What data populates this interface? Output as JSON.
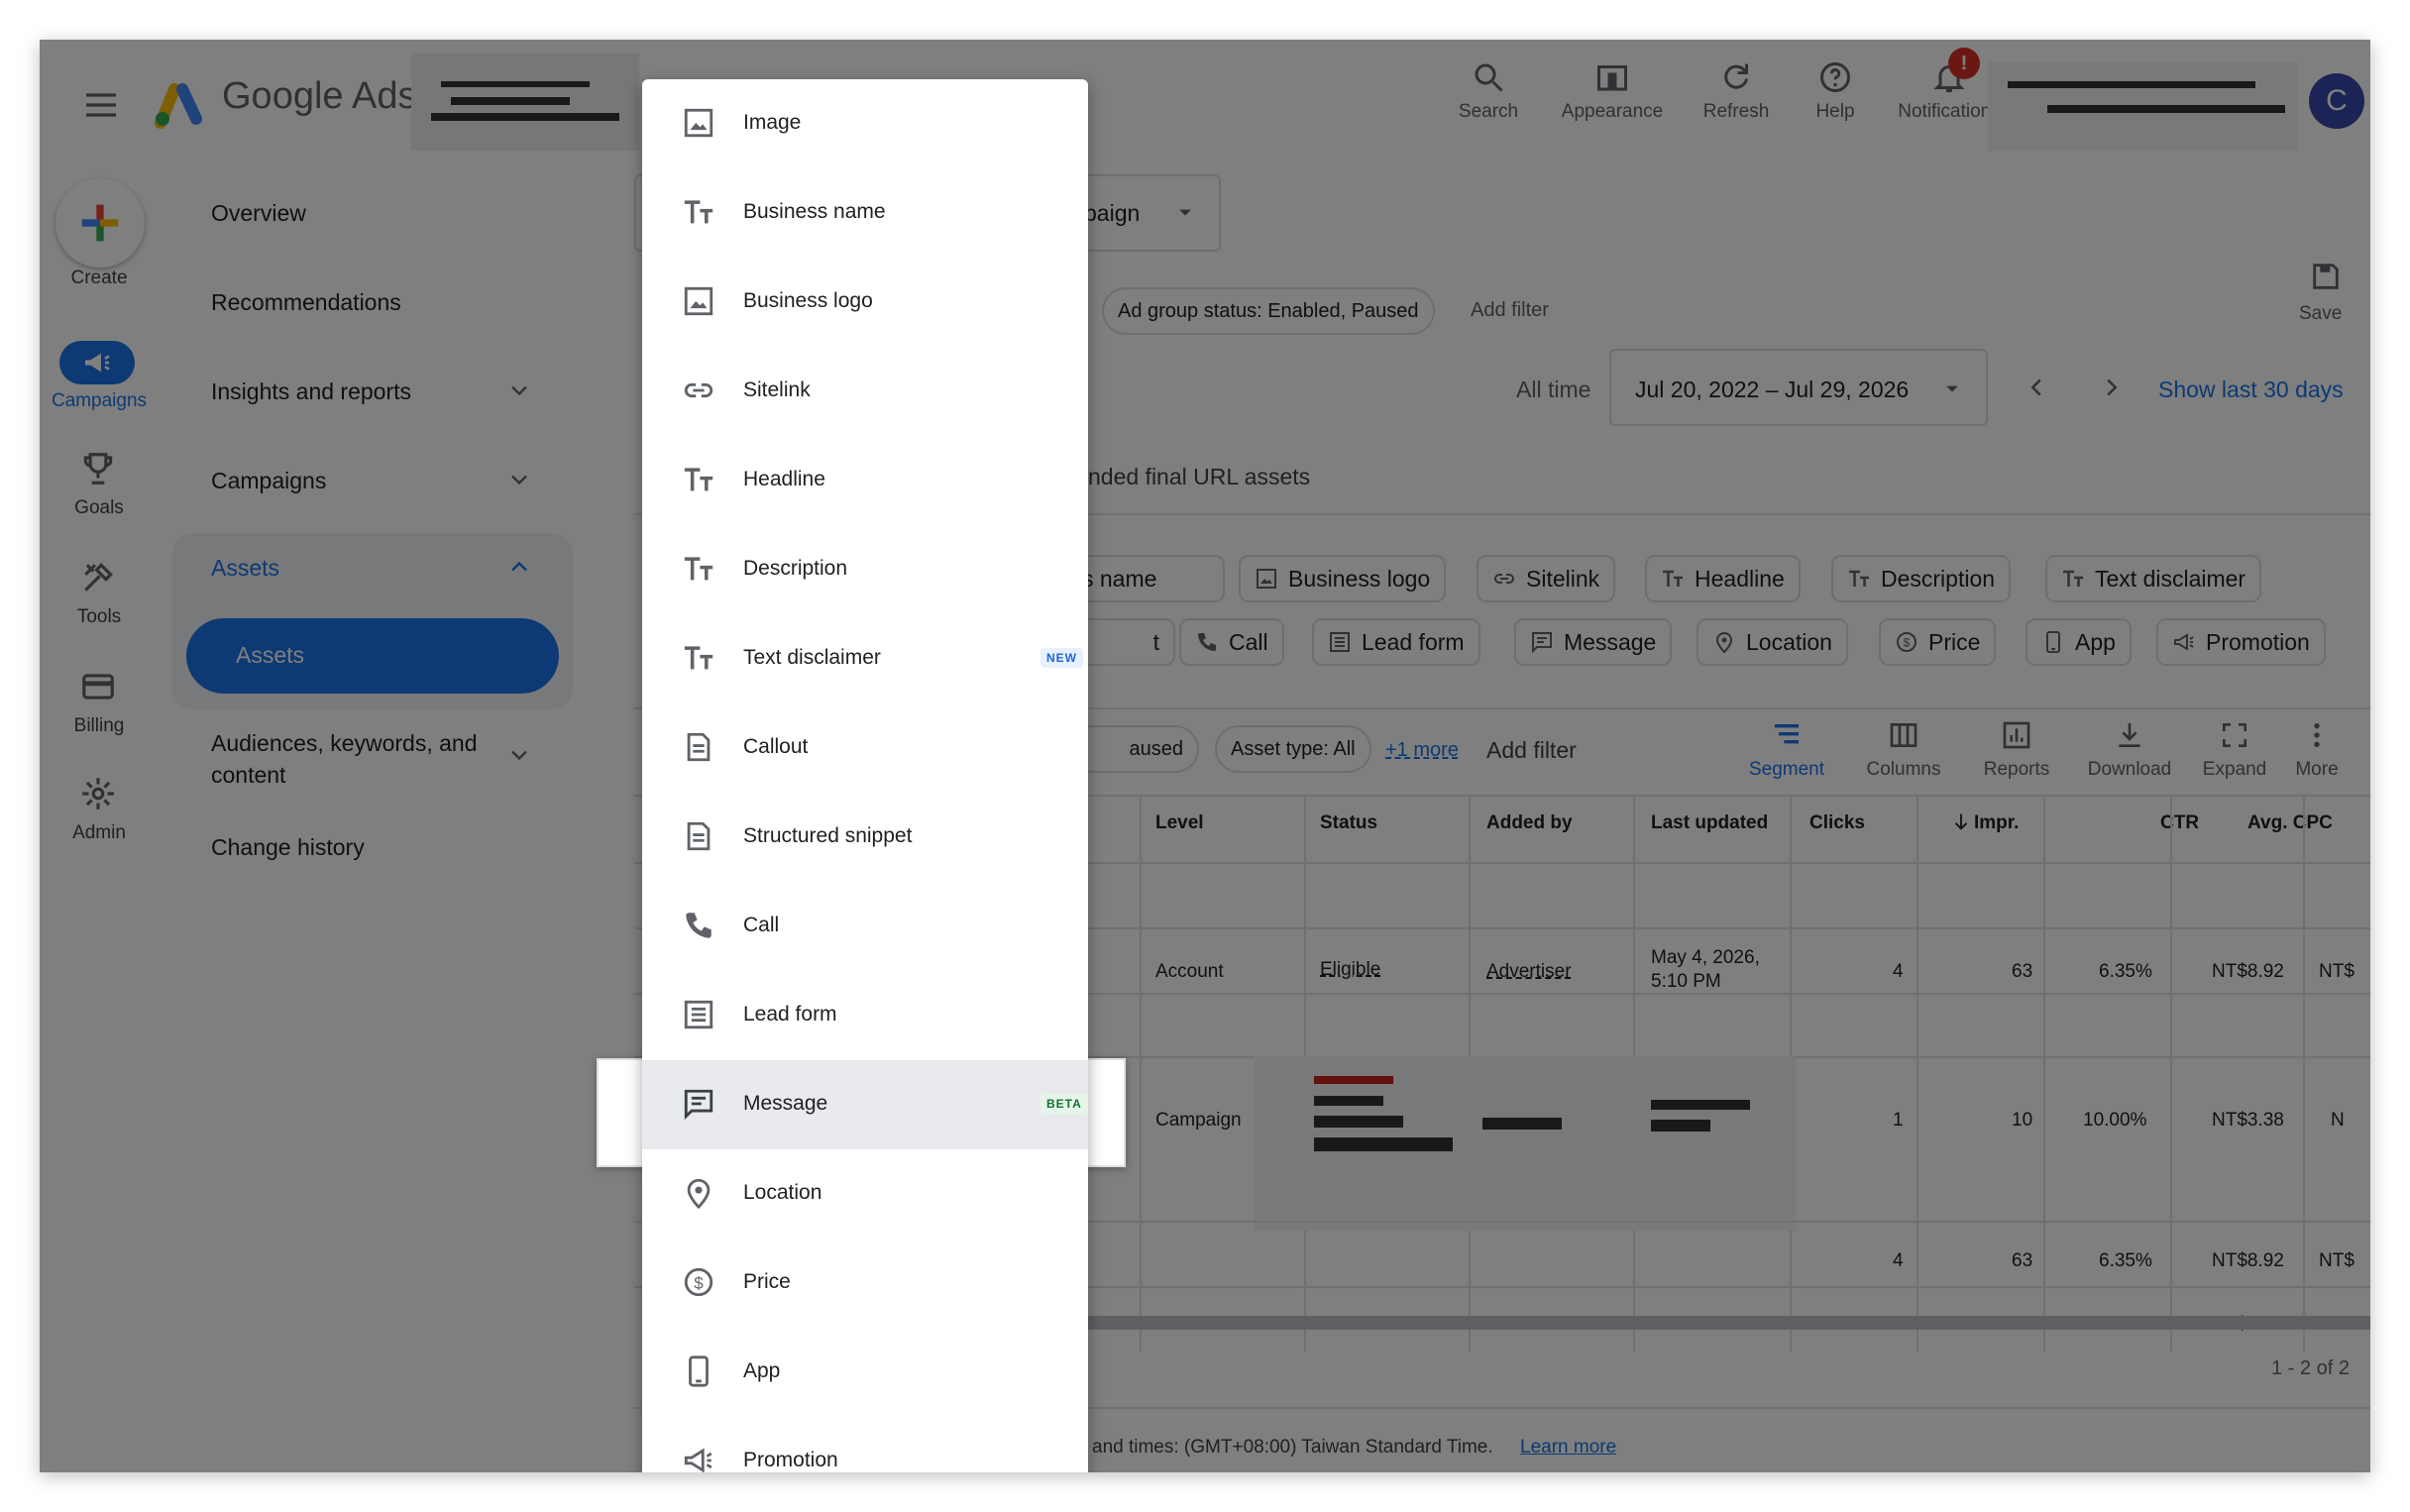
{
  "app": {
    "title": "Google Ads",
    "avatar_initial": "C"
  },
  "topbar": {
    "actions": [
      {
        "label": "Search",
        "icon": "search-icon"
      },
      {
        "label": "Appearance",
        "icon": "appearance-icon"
      },
      {
        "label": "Refresh",
        "icon": "refresh-icon"
      },
      {
        "label": "Help",
        "icon": "help-icon"
      },
      {
        "label": "Notifications",
        "icon": "bell-icon",
        "badge": "!"
      }
    ]
  },
  "rail": {
    "create": "Create",
    "items": [
      {
        "label": "Campaigns",
        "icon": "megaphone-icon",
        "active": true
      },
      {
        "label": "Goals",
        "icon": "trophy-icon"
      },
      {
        "label": "Tools",
        "icon": "tools-icon"
      },
      {
        "label": "Billing",
        "icon": "card-icon"
      },
      {
        "label": "Admin",
        "icon": "gear-icon"
      }
    ]
  },
  "nav": {
    "items": [
      {
        "label": "Overview"
      },
      {
        "label": "Recommendations"
      },
      {
        "label": "Insights and reports"
      },
      {
        "label": "Campaigns"
      },
      {
        "label": "Assets"
      },
      {
        "label": "Assets"
      },
      {
        "label": "Audiences, keywords, and content"
      },
      {
        "label": "Change history"
      }
    ]
  },
  "main": {
    "campaign_select_suffix": "paign",
    "filter_chip": "Ad group status: Enabled, Paused",
    "add_filter": "Add filter",
    "save": "Save",
    "date_label": "All time",
    "date_range": "Jul 20, 2022 – Jul 29, 2026",
    "show_last": "Show last 30 days",
    "tab_partial": "nded final URL assets",
    "asset_chips_row1": [
      "s name",
      "Business logo",
      "Sitelink",
      "Headline",
      "Description",
      "Text disclaimer"
    ],
    "asset_chips_row2": [
      "t",
      "Call",
      "Lead form",
      "Message",
      "Location",
      "Price",
      "App",
      "Promotion"
    ],
    "filters_row": {
      "paused_partial": "aused",
      "asset_type": "Asset type: All",
      "more": "+1 more",
      "add_filter": "Add filter"
    },
    "tools": [
      "Segment",
      "Columns",
      "Reports",
      "Download",
      "Expand",
      "More"
    ],
    "columns": [
      "Level",
      "Status",
      "Added by",
      "Last updated",
      "Clicks",
      "Impr.",
      "CTR",
      "Avg. CPC"
    ],
    "rows": [
      {
        "level": "Account",
        "status": "Eligible",
        "added_by": "Advertiser",
        "updated_1": "May 4, 2026,",
        "updated_2": "5:10 PM",
        "clicks": "4",
        "impr": "63",
        "ctr": "6.35%",
        "cpc": "NT$8.92",
        "cut": "NT$"
      },
      {
        "level": "Campaign",
        "clicks": "1",
        "impr": "10",
        "ctr": "10.00%",
        "cpc": "NT$3.38",
        "cut": "N"
      }
    ],
    "totals": [
      {
        "clicks": "4",
        "impr": "63",
        "ctr": "6.35%",
        "cpc": "NT$8.92",
        "cut": "NT$"
      },
      {
        "clicks": "1",
        "impr": "10",
        "ctr": "10.00%",
        "cpc": "NT$3.38",
        "cut": "N"
      }
    ],
    "pagination": "1 - 2 of 2",
    "footer_text": "and times: (GMT+08:00) Taiwan Standard Time.",
    "footer_link": "Learn more"
  },
  "menu": {
    "items": [
      {
        "label": "Image",
        "icon": "image-icon"
      },
      {
        "label": "Business name",
        "icon": "text-icon"
      },
      {
        "label": "Business logo",
        "icon": "image-icon"
      },
      {
        "label": "Sitelink",
        "icon": "link-icon"
      },
      {
        "label": "Headline",
        "icon": "text-icon"
      },
      {
        "label": "Description",
        "icon": "text-icon"
      },
      {
        "label": "Text disclaimer",
        "icon": "text-icon",
        "badge": "NEW"
      },
      {
        "label": "Callout",
        "icon": "document-icon"
      },
      {
        "label": "Structured snippet",
        "icon": "document-icon"
      },
      {
        "label": "Call",
        "icon": "phone-icon"
      },
      {
        "label": "Lead form",
        "icon": "form-icon"
      },
      {
        "label": "Message",
        "icon": "message-icon",
        "badge": "BETA",
        "highlighted": true
      },
      {
        "label": "Location",
        "icon": "location-icon"
      },
      {
        "label": "Price",
        "icon": "price-icon"
      },
      {
        "label": "App",
        "icon": "app-icon"
      },
      {
        "label": "Promotion",
        "icon": "promotion-icon"
      }
    ]
  },
  "colors": {
    "accent": "#1a73e8",
    "nav_active": "#1a73e8",
    "new_badge_bg": "#e8f0fe",
    "beta_badge_bg": "#e6f4ea",
    "notification": "#d93025"
  }
}
